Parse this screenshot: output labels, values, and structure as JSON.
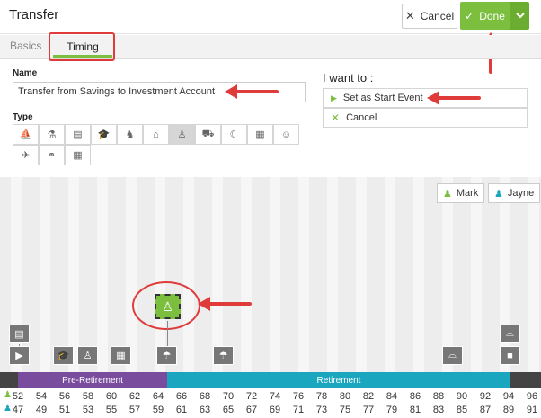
{
  "header": {
    "title": "Transfer",
    "cancel_label": "Cancel",
    "done_label": "Done"
  },
  "tabs": {
    "basics": "Basics",
    "timing": "Timing"
  },
  "form": {
    "name_label": "Name",
    "name_value": "Transfer from Savings to Investment Account",
    "type_label": "Type",
    "type_icons": [
      "sailboat-icon",
      "flask-icon",
      "book-icon",
      "graduation-cap-icon",
      "rocking-horse-icon",
      "house-icon",
      "money-bag-icon",
      "car-icon",
      "moon-icon",
      "gift-icon",
      "family-icon",
      "plane-icon",
      "rings-icon",
      "calendar-icon"
    ],
    "selected_type": "money-bag-icon"
  },
  "iwant": {
    "title": "I want to :",
    "options": [
      "Set as Start Event",
      "Cancel"
    ]
  },
  "people": {
    "mark": "Mark",
    "jayne": "Jayne",
    "mark_color": "#7cbf3f",
    "jayne_color": "#1aa6bf"
  },
  "timeline": {
    "phases": [
      "Pre-Retirement",
      "Retirement"
    ],
    "ages_mark": [
      "52",
      "54",
      "56",
      "58",
      "60",
      "62",
      "64",
      "66",
      "68",
      "70",
      "72",
      "74",
      "76",
      "78",
      "80",
      "82",
      "84",
      "86",
      "88",
      "90",
      "92",
      "94",
      "96"
    ],
    "ages_jayne": [
      "47",
      "49",
      "51",
      "53",
      "55",
      "57",
      "59",
      "61",
      "63",
      "65",
      "67",
      "69",
      "71",
      "73",
      "75",
      "77",
      "79",
      "81",
      "83",
      "85",
      "87",
      "89",
      "91"
    ]
  },
  "colors": {
    "accent": "#7cbf3f",
    "pre_retirement": "#7a4c9e",
    "retirement": "#1aa6bf",
    "annotation": "#e03b3b"
  }
}
